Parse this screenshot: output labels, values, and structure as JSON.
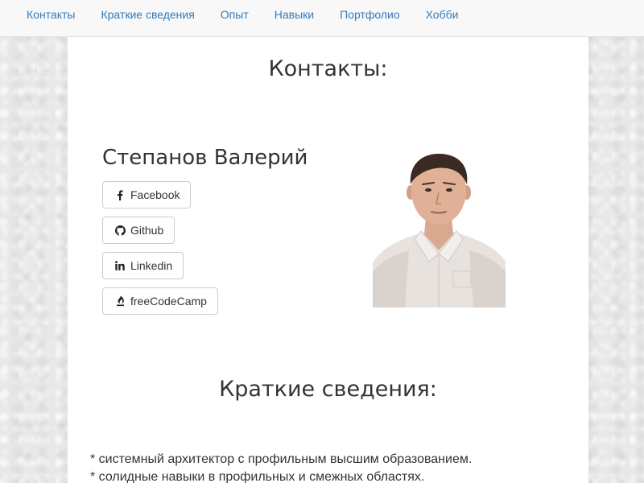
{
  "nav": {
    "items": [
      {
        "label": "Контакты"
      },
      {
        "label": "Краткие сведения"
      },
      {
        "label": "Опыт"
      },
      {
        "label": "Навыки"
      },
      {
        "label": "Портфолио"
      },
      {
        "label": "Хобби"
      }
    ]
  },
  "contacts": {
    "title": "Контакты:",
    "name": "Степанов Валерий",
    "buttons": [
      {
        "label": "Facebook",
        "icon": "facebook-icon"
      },
      {
        "label": "Github",
        "icon": "github-icon"
      },
      {
        "label": "Linkedin",
        "icon": "linkedin-icon"
      },
      {
        "label": "freeCodeCamp",
        "icon": "free-code-camp-icon"
      }
    ]
  },
  "summary": {
    "title": "Краткие сведения:",
    "lines": [
      "* системный архитектор с профильным высшим образованием.",
      "* солидные навыки в профильных и смежных областях."
    ]
  },
  "colors": {
    "link": "#337ab7",
    "text": "#333333",
    "navbar_bg": "#f8f8f8",
    "container_bg": "#ffffff"
  }
}
